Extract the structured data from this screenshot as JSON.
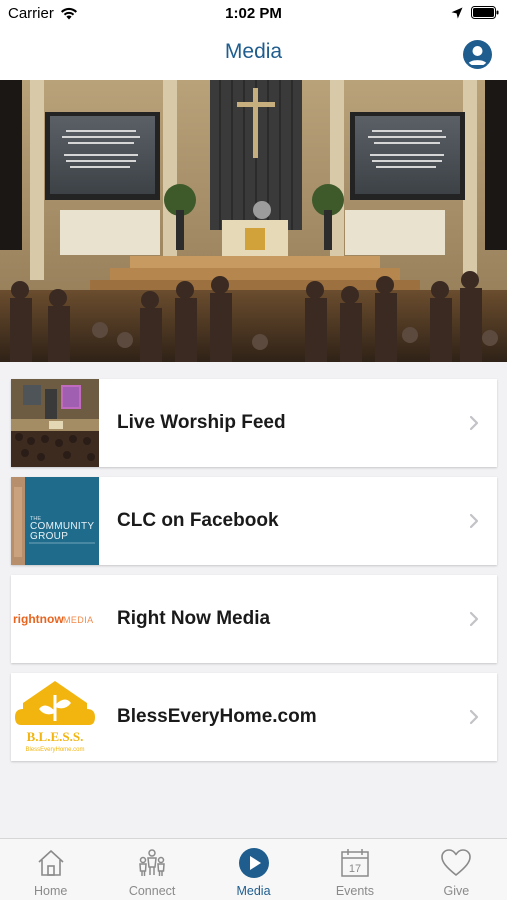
{
  "status_bar": {
    "carrier": "Carrier",
    "time": "1:02 PM"
  },
  "nav": {
    "title": "Media"
  },
  "media_items": [
    {
      "label": "Live Worship Feed",
      "thumb": "worship-sanctuary-thumbnail"
    },
    {
      "label": "CLC on Facebook",
      "thumb": "community-group-thumbnail",
      "thumb_text": [
        "THE",
        "COMMUNITY",
        "GROUP"
      ]
    },
    {
      "label": "Right Now Media",
      "thumb": "rightnow-media-logo",
      "thumb_text": {
        "brand": "rightnow",
        "suffix": "MEDIA"
      }
    },
    {
      "label": "BlessEveryHome.com",
      "thumb": "bless-logo",
      "thumb_text": {
        "title": "B.L.E.S.S.",
        "url": "BlessEveryHome.com"
      }
    }
  ],
  "tabs": [
    {
      "label": "Home",
      "icon": "house-icon",
      "active": false
    },
    {
      "label": "Connect",
      "icon": "people-icon",
      "active": false
    },
    {
      "label": "Media",
      "icon": "play-icon",
      "active": true
    },
    {
      "label": "Events",
      "icon": "calendar-icon",
      "active": false,
      "icon_text": "17"
    },
    {
      "label": "Give",
      "icon": "heart-icon",
      "active": false
    }
  ],
  "colors": {
    "accent": "#1f5d8f",
    "tab_inactive": "#8a8a8a",
    "bless_yellow": "#f2b50f",
    "rightnow_orange": "#e8641e"
  }
}
